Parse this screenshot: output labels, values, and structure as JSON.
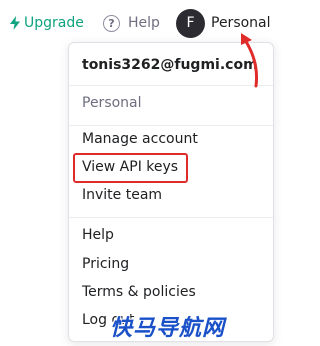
{
  "topbar": {
    "upgrade_label": "Upgrade",
    "help_label": "Help",
    "help_glyph": "?",
    "avatar_initial": "F",
    "account_label": "Personal"
  },
  "menu": {
    "email": "tonis3262@fugmi.com",
    "org_label": "Personal",
    "group1": [
      "Manage account",
      "View API keys",
      "Invite team"
    ],
    "group2": [
      "Help",
      "Pricing",
      "Terms & policies",
      "Log out"
    ],
    "highlighted_item": "View API keys"
  },
  "watermark": "快马导航网",
  "icons": {
    "upgrade": "lightning-bolt-icon",
    "help": "question-circle-icon",
    "annotation": "red-arrow-annotation"
  },
  "colors": {
    "upgrade": "#10a37f",
    "highlight": "#e02b2b",
    "avatar_bg": "#2b2b31",
    "watermark": "#1a50c8"
  }
}
